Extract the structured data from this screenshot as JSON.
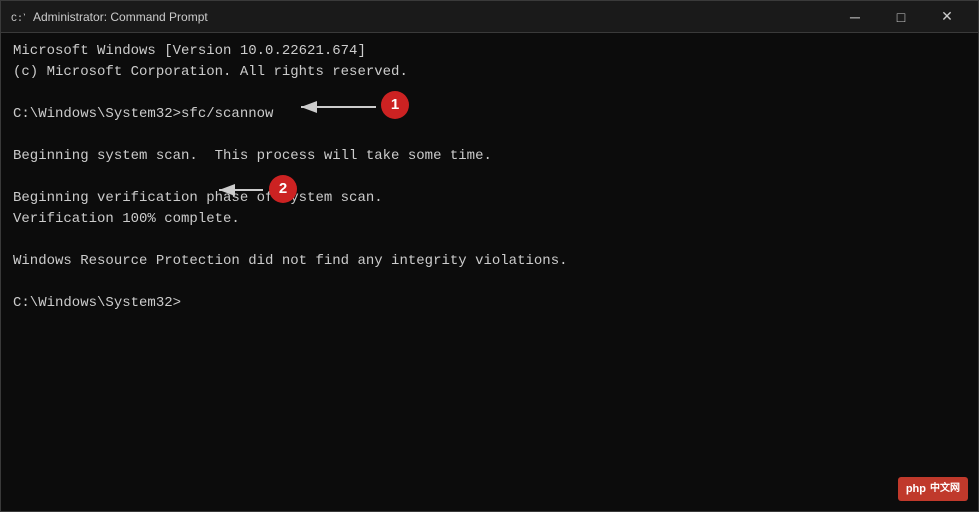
{
  "window": {
    "title": "Administrator: Command Prompt",
    "icon": "cmd-icon"
  },
  "titlebar": {
    "minimize_label": "─",
    "maximize_label": "□",
    "close_label": "✕"
  },
  "console": {
    "lines": [
      "Microsoft Windows [Version 10.0.22621.674]",
      "(c) Microsoft Corporation. All rights reserved.",
      "",
      "C:\\Windows\\System32>sfc/scannow",
      "",
      "Beginning system scan.  This process will take some time.",
      "",
      "Beginning verification phase of system scan.",
      "Verification 100% complete.",
      "",
      "Windows Resource Protection did not find any integrity violations.",
      "",
      "C:\\Windows\\System32>"
    ]
  },
  "annotations": {
    "badge1_label": "1",
    "badge2_label": "2"
  },
  "watermark": {
    "brand": "php",
    "lang": "中文网"
  }
}
